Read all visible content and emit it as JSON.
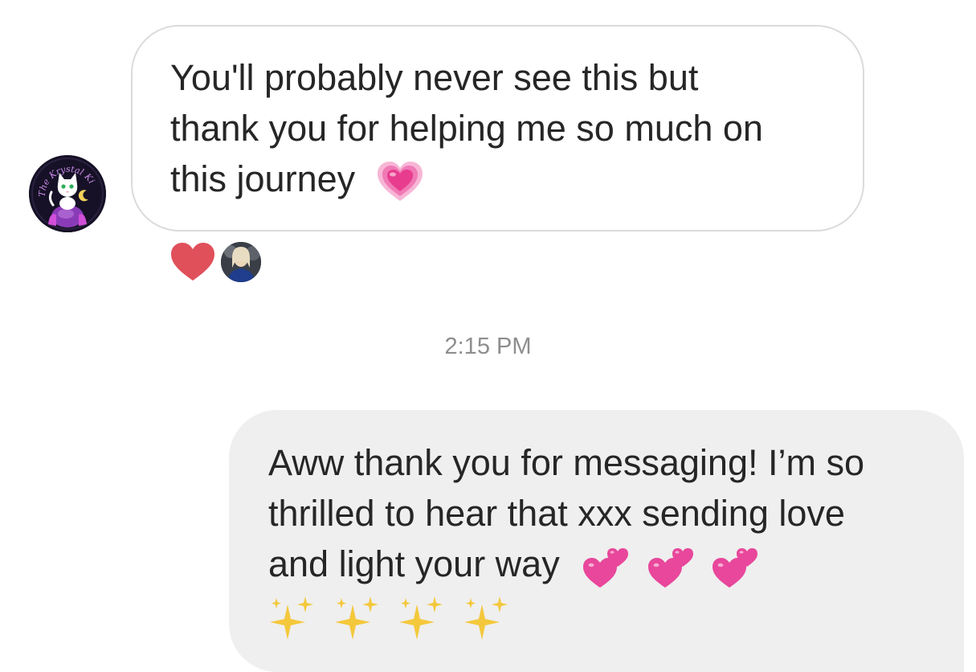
{
  "thread": {
    "incoming": {
      "sender_avatar_icon": "crystal-kitty-logo-icon",
      "avatar_text": "The Krystal Kitty",
      "lines": [
        "You'll probably never see this but",
        "thank you for helping me so much on",
        "this journey"
      ],
      "trailing_emoji": "growing-heart-icon",
      "reaction": {
        "emoji": "red-heart-icon",
        "reactor_avatar_icon": "user-avatar-icon"
      }
    },
    "timestamp": "2:15 PM",
    "outgoing": {
      "lines": [
        "Aww thank you for messaging! I’m so",
        "thrilled to hear that xxx sending love",
        "and light your way"
      ],
      "emojis_line3": [
        "two-hearts-icon",
        "two-hearts-icon",
        "two-hearts-icon"
      ],
      "emojis_line4": [
        "sparkles-icon",
        "sparkles-icon",
        "sparkles-icon",
        "sparkles-icon"
      ]
    }
  },
  "colors": {
    "incoming_border": "#dbdbdb",
    "outgoing_background": "#efefef",
    "timestamp_text": "#8e8e8e",
    "reaction_heart": "#e0505b",
    "pink_heart": "#e8479b",
    "sparkle": "#f4c83c"
  }
}
